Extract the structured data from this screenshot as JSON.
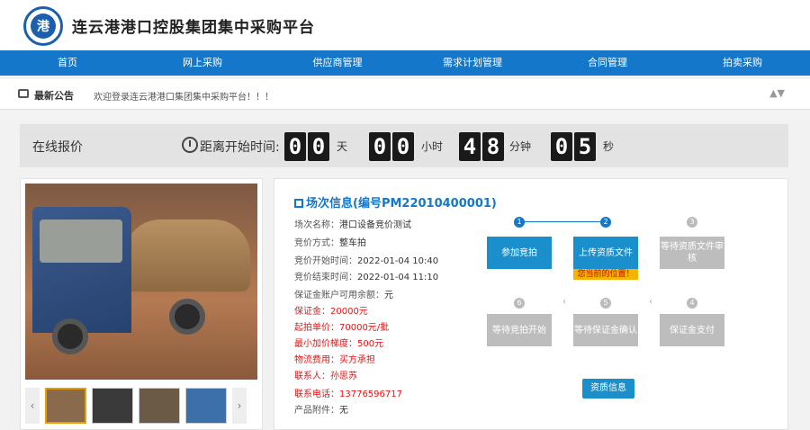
{
  "header": {
    "site_title": "连云港港口控股集团集中采购平台"
  },
  "nav": {
    "items": [
      "首页",
      "网上采购",
      "供应商管理",
      "需求计划管理",
      "合同管理",
      "拍卖采购"
    ]
  },
  "notice": {
    "label": "最新公告",
    "text": "欢迎登录连云港港口集团集中采购平台！！！"
  },
  "countdown": {
    "title": "在线报价",
    "label": "距离开始时间:",
    "days": "00",
    "hours": "00",
    "minutes": "48",
    "seconds": "05",
    "unit_day": "天",
    "unit_hour": "小时",
    "unit_min": "分钟",
    "unit_sec": "秒"
  },
  "info": {
    "title": "场次信息(编号PM22010400001)",
    "fields": [
      {
        "k": "场次名称：",
        "v": "港口设备竞价测试"
      },
      {
        "k": "竞价方式：",
        "v": "整车拍"
      },
      {
        "k": "竞价开始时间：",
        "v": "2022-01-04 10:40"
      },
      {
        "k": "竞价结束时间：",
        "v": "2022-01-04 11:10"
      },
      {
        "k": "保证金账户可用余额：",
        "v": "元"
      },
      {
        "k": "保证金：",
        "v": "20000元"
      },
      {
        "k": "起拍单价：",
        "v": "70000元/批"
      },
      {
        "k": "最小加价梯度：",
        "v": "500元"
      },
      {
        "k": "物流费用：",
        "v": "买方承担"
      },
      {
        "k": "联系人：",
        "v": "孙思苏"
      },
      {
        "k": "联系电话：",
        "v": "13776596717"
      },
      {
        "k": "产品附件：",
        "v": "无"
      }
    ]
  },
  "steps": {
    "dots": [
      "1",
      "2",
      "3",
      "6",
      "5",
      "4"
    ],
    "b1": "参加竞拍",
    "b2": "上传资质文件",
    "tip": "您当前的位置！",
    "b3": "等待资质文件审核",
    "b4": "等待竞拍开始",
    "b5": "等待保证金确认",
    "b6": "保证金支付",
    "qual_button": "资质信息"
  },
  "colors": {
    "primary": "#1577c9",
    "button": "#1a8fcc",
    "alert": "#e11111",
    "tip": "#f4b400"
  }
}
